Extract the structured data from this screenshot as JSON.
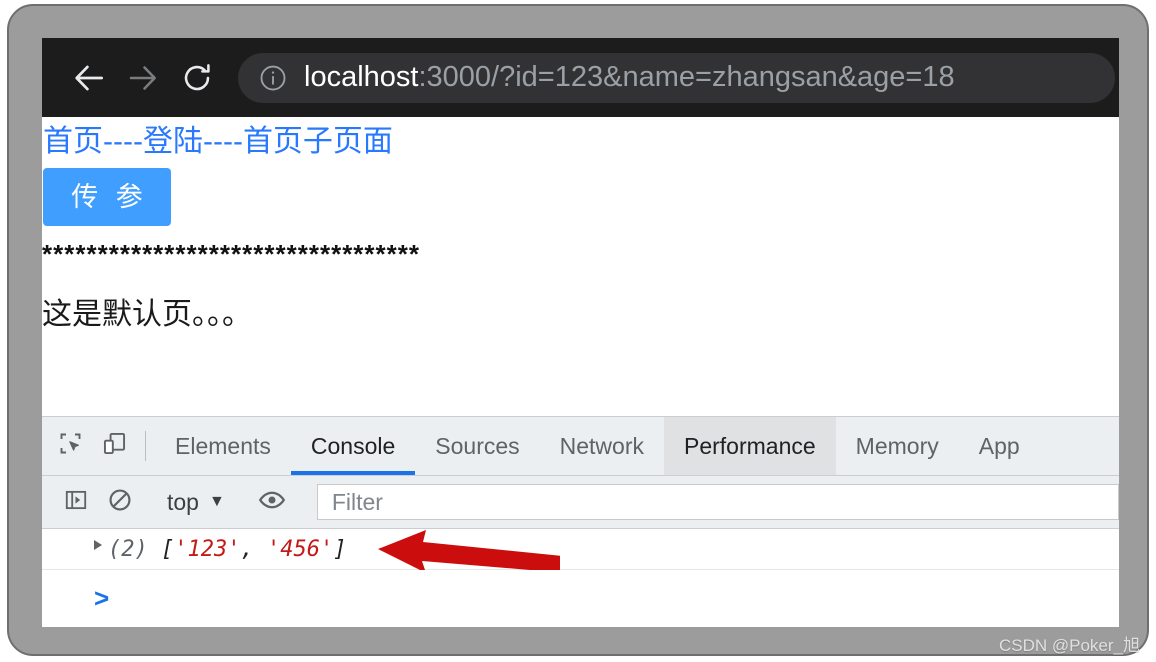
{
  "browser": {
    "back_icon": "arrow-left-icon",
    "forward_icon": "arrow-right-icon",
    "reload_icon": "reload-icon",
    "site_info_icon": "info-circle-icon",
    "url_host": "localhost",
    "url_rest": ":3000/?id=123&name=zhangsan&age=18",
    "url_full": "localhost:3000/?id=123&name=zhangsan&age=18"
  },
  "page": {
    "nav_links": [
      {
        "label": "首页"
      },
      {
        "label": "登陆"
      },
      {
        "label": "首页子页面"
      }
    ],
    "nav_separator": "----",
    "button_label": "传 参",
    "stars_line": "**********************************",
    "body_text": "这是默认页。。。"
  },
  "devtools": {
    "inspect_icon": "inspect-element-icon",
    "device_icon": "device-toolbar-icon",
    "tabs": [
      {
        "label": "Elements",
        "state": "normal"
      },
      {
        "label": "Console",
        "state": "active"
      },
      {
        "label": "Sources",
        "state": "normal"
      },
      {
        "label": "Network",
        "state": "normal"
      },
      {
        "label": "Performance",
        "state": "hovered"
      },
      {
        "label": "Memory",
        "state": "normal"
      },
      {
        "label": "App",
        "state": "clipped"
      }
    ],
    "console_toolbar": {
      "sidebar_icon": "console-sidebar-icon",
      "clear_icon": "clear-console-icon",
      "context_label": "top",
      "context_caret": "▼",
      "eye_icon": "live-expression-eye-icon",
      "filter_placeholder": "Filter",
      "filter_value": ""
    },
    "console_output": {
      "disclosure_icon": "expand-triangle-icon",
      "count_label": "(2)",
      "open_bracket": "[",
      "items": [
        "'123'",
        "'456'"
      ],
      "item_separator": ", ",
      "close_bracket": "]",
      "prompt_symbol": ">"
    }
  },
  "annotation": {
    "arrow_icon": "red-arrow-left-icon",
    "arrow_color": "#cc0d0d"
  },
  "watermark": {
    "text": "CSDN @Poker_旭"
  },
  "colors": {
    "chrome_bg": "#1c1c1c",
    "omnibox_bg": "#323234",
    "link_blue": "#2979ff",
    "button_blue": "#409eff",
    "tab_active_underline": "#1a73e8",
    "console_string_red": "#c41a16",
    "frame_gray": "#9c9c9c"
  }
}
